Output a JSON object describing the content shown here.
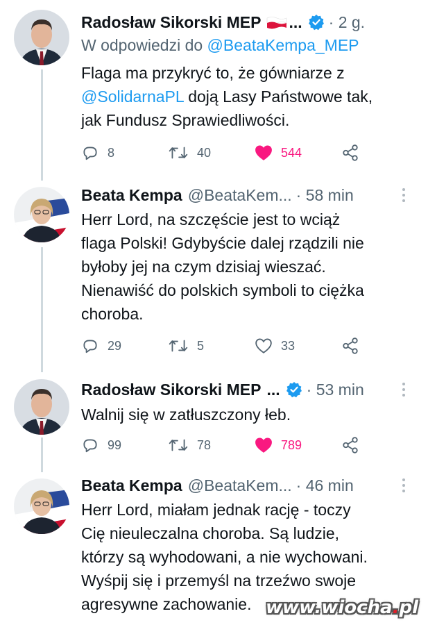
{
  "tweets": [
    {
      "name": "Radosław Sikorski MEP",
      "ellipsis": "...",
      "handle": "",
      "time": "· 2 g.",
      "reply_prefix": "W odpowiedzi do",
      "reply_mention": "@BeataKempa_MEP",
      "lines": [
        {
          "a": "Flaga ma przykryć to, że gówniarze z",
          "m": "",
          "b": ""
        },
        {
          "a": "",
          "m": "@SolidarnaPL",
          "b": " doją Lasy Państwowe tak,"
        },
        {
          "a": "jak Fundusz Sprawiedliwości.",
          "m": "",
          "b": ""
        }
      ],
      "replies": "8",
      "retweets": "40",
      "likes": "544",
      "liked": true
    },
    {
      "name": "Beata Kempa",
      "ellipsis": "",
      "handle": "@BeataKem...",
      "time": "· 58 min",
      "lines": [
        {
          "a": "Herr Lord, na szczęście jest to wciąż"
        },
        {
          "a": "flaga Polski! Gdybyście dalej rządzili nie"
        },
        {
          "a": "byłoby jej na czym dzisiaj wieszać."
        },
        {
          "a": "Nienawiść do polskich symboli to ciężka"
        },
        {
          "a": "choroba."
        }
      ],
      "replies": "29",
      "retweets": "5",
      "likes": "33",
      "liked": false
    },
    {
      "name": "Radosław Sikorski MEP",
      "ellipsis": "...",
      "handle": "",
      "time": "· 53 min",
      "lines": [
        {
          "a": "Walnij się w zatłuszczony łeb."
        }
      ],
      "replies": "99",
      "retweets": "78",
      "likes": "789",
      "liked": true
    },
    {
      "name": "Beata Kempa",
      "ellipsis": "",
      "handle": "@BeataKem...",
      "time": "· 46 min",
      "lines": [
        {
          "a": "Herr Lord, miałam jednak rację - toczy"
        },
        {
          "a": "Cię nieuleczalna choroba. Są ludzie,"
        },
        {
          "a": "którzy są wyhodowani, a nie wychowani."
        },
        {
          "a": "Wyśpij się i przemyśl na trzeźwo swoje"
        },
        {
          "a": "agresywne zachowanie."
        }
      ]
    }
  ],
  "watermark": {
    "pre": "www.wiocha",
    "dot": ".",
    "post": "pl"
  },
  "colors": {
    "accent": "#1d9bf0",
    "like": "#f91880",
    "muted": "#536471",
    "thread": "#cfd9de"
  }
}
